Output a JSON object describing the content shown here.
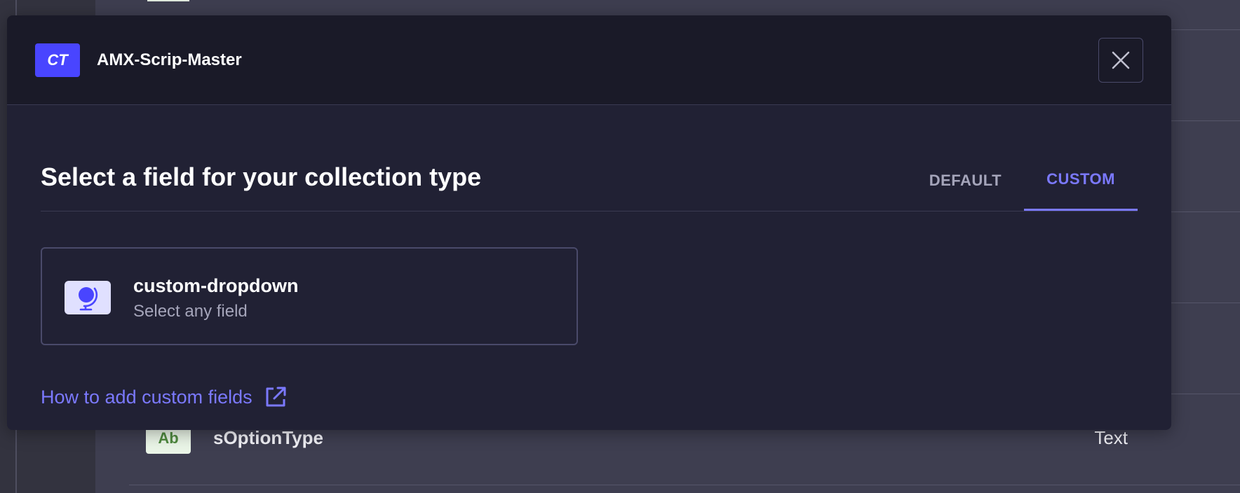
{
  "background": {
    "row": {
      "icon_text": "Ab",
      "field_name": "sOptionType",
      "field_type": "Text"
    }
  },
  "modal": {
    "badge": "CT",
    "title": "AMX-Scrip-Master",
    "close_icon": "close-icon",
    "heading": "Select a field for your collection type",
    "tabs": [
      {
        "label": "DEFAULT",
        "active": false
      },
      {
        "label": "CUSTOM",
        "active": true
      }
    ],
    "custom_fields": [
      {
        "icon": "globe-icon",
        "name": "custom-dropdown",
        "description": "Select any field"
      }
    ],
    "help_link": {
      "label": "How to add custom fields",
      "icon": "external-link-icon"
    }
  },
  "colors": {
    "accent": "#7b79ff",
    "badge": "#4945ff",
    "modal_bg": "#212134",
    "header_bg": "#1a1a28"
  }
}
